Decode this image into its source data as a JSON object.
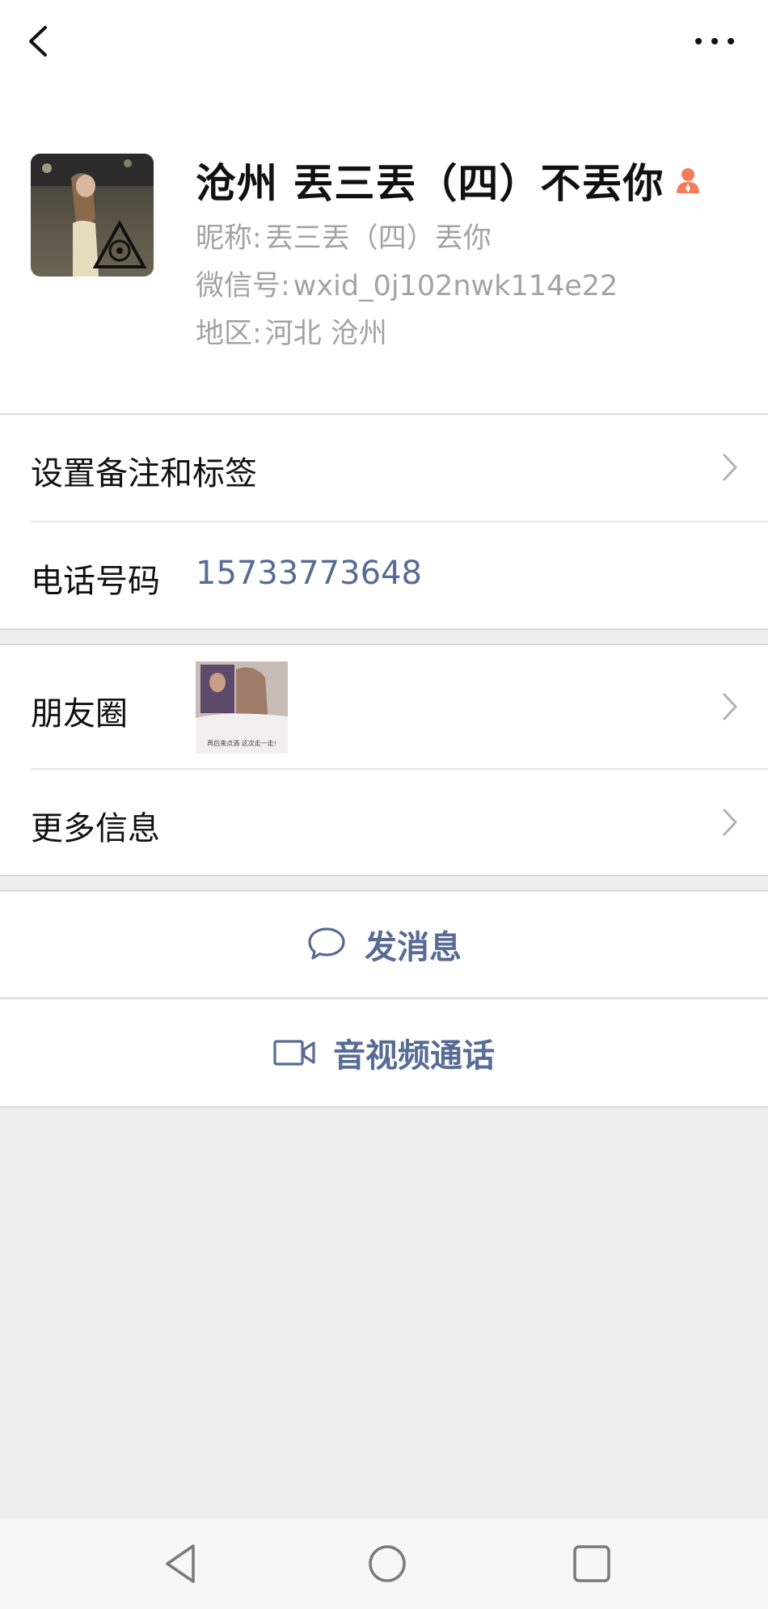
{
  "profile": {
    "display_name": "沧州 丟三丟（四）不丟你",
    "nickname_label": "昵称:",
    "nickname": "丟三丟（四）丟你",
    "wechat_id_label": "微信号:",
    "wechat_id": "wxid_0j102nwk114e22",
    "region_label": "地区:",
    "region": "河北  沧州"
  },
  "cells": {
    "remarks_tags_label": "设置备注和标签",
    "phone_label": "电话号码",
    "phone_value": "15733773648",
    "moments_label": "朋友圈",
    "moments_thumb_caption": "再后来点酒 这次走一走!",
    "more_info_label": "更多信息"
  },
  "actions": {
    "send_message_label": "发消息",
    "video_call_label": "音视频通话"
  },
  "icons": {
    "back": "chevron-left-icon",
    "more": "more-dots-icon",
    "official": "official-account-icon",
    "chat": "chat-bubble-icon",
    "video": "video-camera-icon",
    "nav_back": "triangle-back-icon",
    "nav_home": "circle-home-icon",
    "nav_recent": "square-recent-icon"
  },
  "colors": {
    "accent": "#576b95",
    "official_icon": "#f47b5a",
    "background": "#ededed"
  }
}
